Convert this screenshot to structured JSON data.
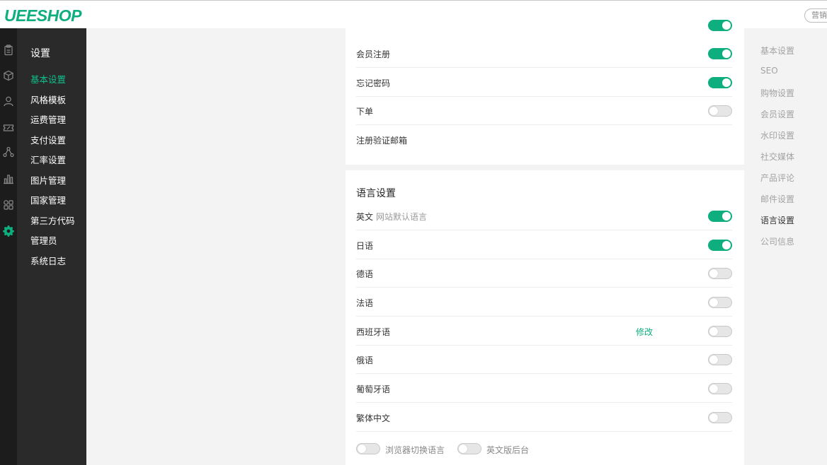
{
  "app": {
    "logo": "UEESHOP",
    "top_button": "营销"
  },
  "rail_icons": [
    "clipboard-icon",
    "box-icon",
    "user-icon",
    "coupon-icon",
    "network-icon",
    "bar-chart-icon",
    "apps-icon",
    "gear-icon"
  ],
  "subnav": {
    "title": "设置",
    "items": [
      "基本设置",
      "风格模板",
      "运费管理",
      "支付设置",
      "汇率设置",
      "图片管理",
      "国家管理",
      "第三方代码",
      "管理员",
      "系统日志"
    ],
    "active_index": 0
  },
  "top_panel": {
    "rows": [
      {
        "label": "会员注册",
        "on": true
      },
      {
        "label": "忘记密码",
        "on": true
      },
      {
        "label": "下单",
        "on": false
      },
      {
        "label": "注册验证邮箱"
      }
    ]
  },
  "language_panel": {
    "title": "语言设置",
    "rows": [
      {
        "label": "英文",
        "hint": "网站默认语言",
        "on": true
      },
      {
        "label": "日语",
        "on": true
      },
      {
        "label": "德语",
        "on": false
      },
      {
        "label": "法语",
        "on": false
      },
      {
        "label": "西班牙语",
        "link": "修改",
        "on": false
      },
      {
        "label": "俄语",
        "on": false
      },
      {
        "label": "葡萄牙语",
        "on": false
      },
      {
        "label": "繁体中文",
        "on": false
      }
    ],
    "options": [
      {
        "label": "浏览器切换语言",
        "on": false
      },
      {
        "label": "英文版后台",
        "on": false
      }
    ]
  },
  "anchor_nav": {
    "items": [
      "基本设置",
      "SEO",
      "购物设置",
      "会员设置",
      "水印设置",
      "社交媒体",
      "产品评论",
      "邮件设置",
      "语言设置",
      "公司信息"
    ],
    "active_index": 8
  },
  "colors": {
    "accent": "#0fae7f",
    "rail_bg": "#1c1c1c",
    "subnav_bg": "#2a2a2a",
    "page_bg": "#f3f3f3"
  }
}
